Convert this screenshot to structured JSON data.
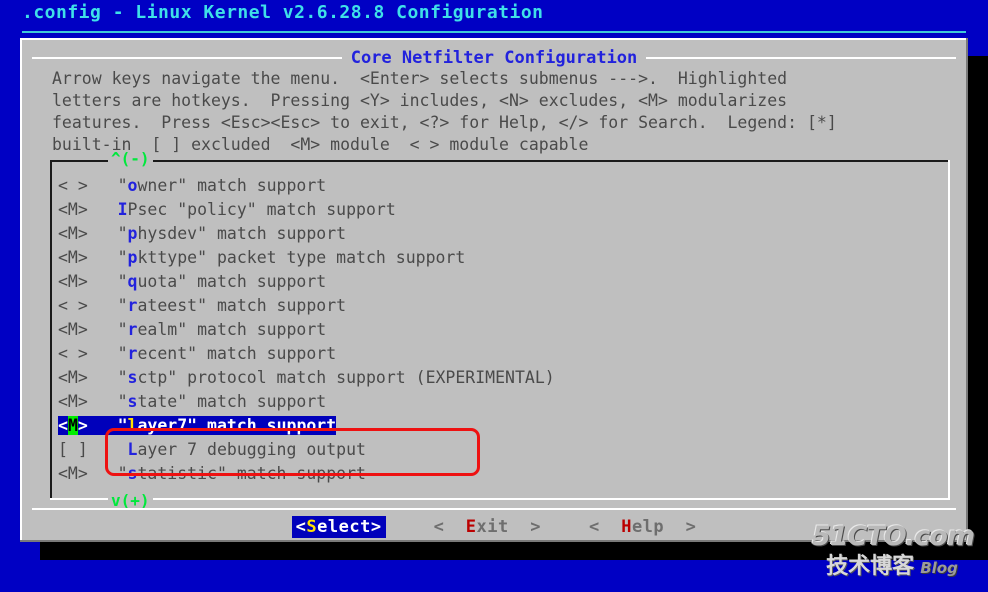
{
  "colors": {
    "desktop_background": "#0000c4",
    "title_text": "#3fe0e8",
    "dialog_background": "#bfbfbf",
    "dialog_title_text": "#2222dd",
    "body_text": "#4a4a4a",
    "hotkey": "#2222dd",
    "selection_background": "#0000bb",
    "selection_text": "#ffffff",
    "selection_hotkey": "#ffe000",
    "marker_background": "#00ee00",
    "scroll_indicator": "#00e83c",
    "button_hotkey": "#bb0000",
    "annotation": "#ee1111"
  },
  "titlebar": {
    "title": ".config - Linux Kernel v2.6.28.8 Configuration"
  },
  "dialog": {
    "title": "Core Netfilter Configuration",
    "help_lines": [
      "Arrow keys navigate the menu.  <Enter> selects submenus --->.  Highlighted",
      "letters are hotkeys.  Pressing <Y> includes, <N> excludes, <M> modularizes",
      "features.  Press <Esc><Esc> to exit, <?> for Help, </> for Search.  Legend: [*]",
      "built-in  [ ] excluded  <M> module  < > module capable"
    ]
  },
  "listbox": {
    "scroll_up": "^(-)",
    "scroll_down": "v(+)",
    "rows": [
      {
        "tag": "< >",
        "indent": "   ",
        "pre": "\"",
        "hot": "o",
        "post": "wner\" match support",
        "selected": false
      },
      {
        "tag": "<M>",
        "indent": "   ",
        "pre": "",
        "hot": "I",
        "post": "Psec \"policy\" match support",
        "selected": false
      },
      {
        "tag": "<M>",
        "indent": "   ",
        "pre": "\"",
        "hot": "p",
        "post": "hysdev\" match support",
        "selected": false
      },
      {
        "tag": "<M>",
        "indent": "   ",
        "pre": "\"",
        "hot": "p",
        "post": "kttype\" packet type match support",
        "selected": false
      },
      {
        "tag": "<M>",
        "indent": "   ",
        "pre": "\"",
        "hot": "q",
        "post": "uota\" match support",
        "selected": false
      },
      {
        "tag": "< >",
        "indent": "   ",
        "pre": "\"",
        "hot": "r",
        "post": "ateest\" match support",
        "selected": false
      },
      {
        "tag": "<M>",
        "indent": "   ",
        "pre": "\"",
        "hot": "r",
        "post": "ealm\" match support",
        "selected": false
      },
      {
        "tag": "< >",
        "indent": "   ",
        "pre": "\"",
        "hot": "r",
        "post": "ecent\" match support",
        "selected": false
      },
      {
        "tag": "<M>",
        "indent": "   ",
        "pre": "\"",
        "hot": "s",
        "post": "ctp\" protocol match support (EXPERIMENTAL)",
        "selected": false
      },
      {
        "tag": "<M>",
        "indent": "   ",
        "pre": "\"",
        "hot": "s",
        "post": "tate\" match support",
        "selected": false
      },
      {
        "tag": "<M>",
        "indent": "   ",
        "pre": "\"",
        "hot": "l",
        "post": "ayer7\" match support",
        "selected": true,
        "marker": "M"
      },
      {
        "tag": "[ ]",
        "indent": "    ",
        "pre": "",
        "hot": "L",
        "post": "ayer 7 debugging output",
        "selected": false
      },
      {
        "tag": "<M>",
        "indent": "   ",
        "pre": "\"",
        "hot": "s",
        "post": "tatistic\" match support",
        "selected": false
      }
    ]
  },
  "buttons": [
    {
      "left": "<",
      "hot": "S",
      "rest": "elect",
      "right": ">",
      "active": true
    },
    {
      "left": "<  ",
      "hot": "E",
      "rest": "xit",
      "right": "  >",
      "active": false
    },
    {
      "left": "<  ",
      "hot": "H",
      "rest": "elp",
      "right": "  >",
      "active": false
    }
  ],
  "watermark": {
    "main": "51CTO.com",
    "sub": "技术博客",
    "blog": "Blog"
  }
}
